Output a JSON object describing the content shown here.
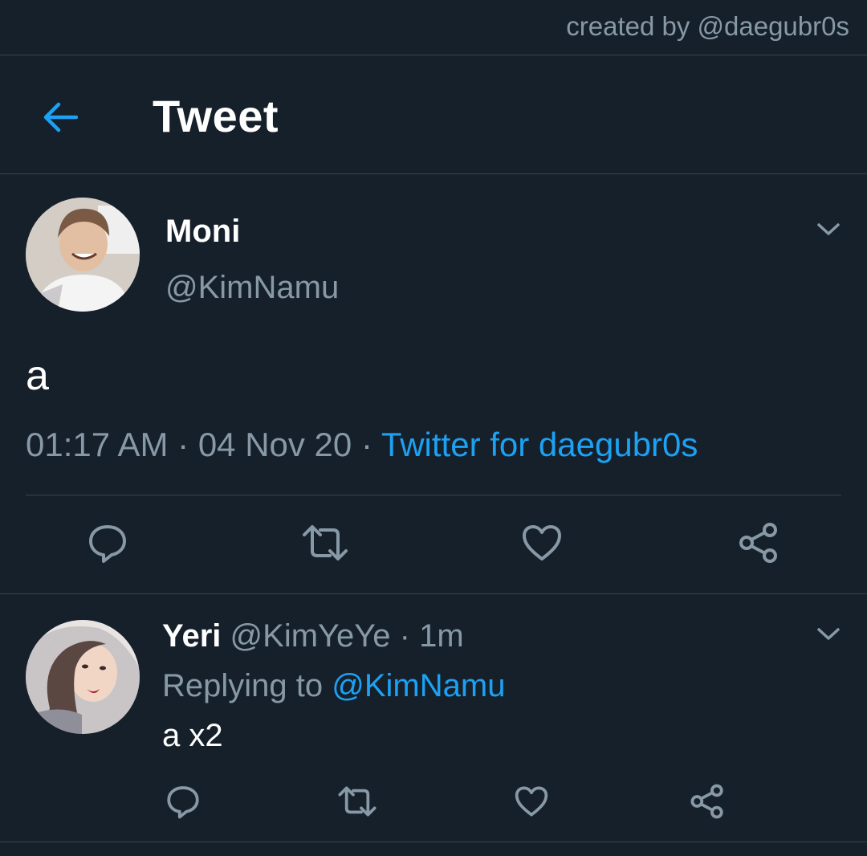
{
  "watermark": "created by @daegubr0s",
  "header": {
    "title": "Tweet",
    "back_icon": "arrow-left-icon"
  },
  "main_tweet": {
    "display_name": "Moni",
    "handle": "@KimNamu",
    "text": "a",
    "time": "01:17 AM",
    "date": "04 Nov 20",
    "separator": "·",
    "source": "Twitter for daegubr0s",
    "actions": [
      "reply-icon",
      "retweet-icon",
      "like-icon",
      "share-icon"
    ]
  },
  "reply_tweet": {
    "display_name": "Yeri",
    "handle": "@KimYeYe",
    "separator": "·",
    "time": "1m",
    "replying_prefix": "Replying to",
    "replying_handle": "@KimNamu",
    "text": "a x2",
    "actions": [
      "reply-icon",
      "retweet-icon",
      "like-icon",
      "share-icon"
    ]
  },
  "colors": {
    "background": "#15202b",
    "accent": "#1da1f2",
    "secondary_text": "#8899a6",
    "divider": "#38444d"
  }
}
